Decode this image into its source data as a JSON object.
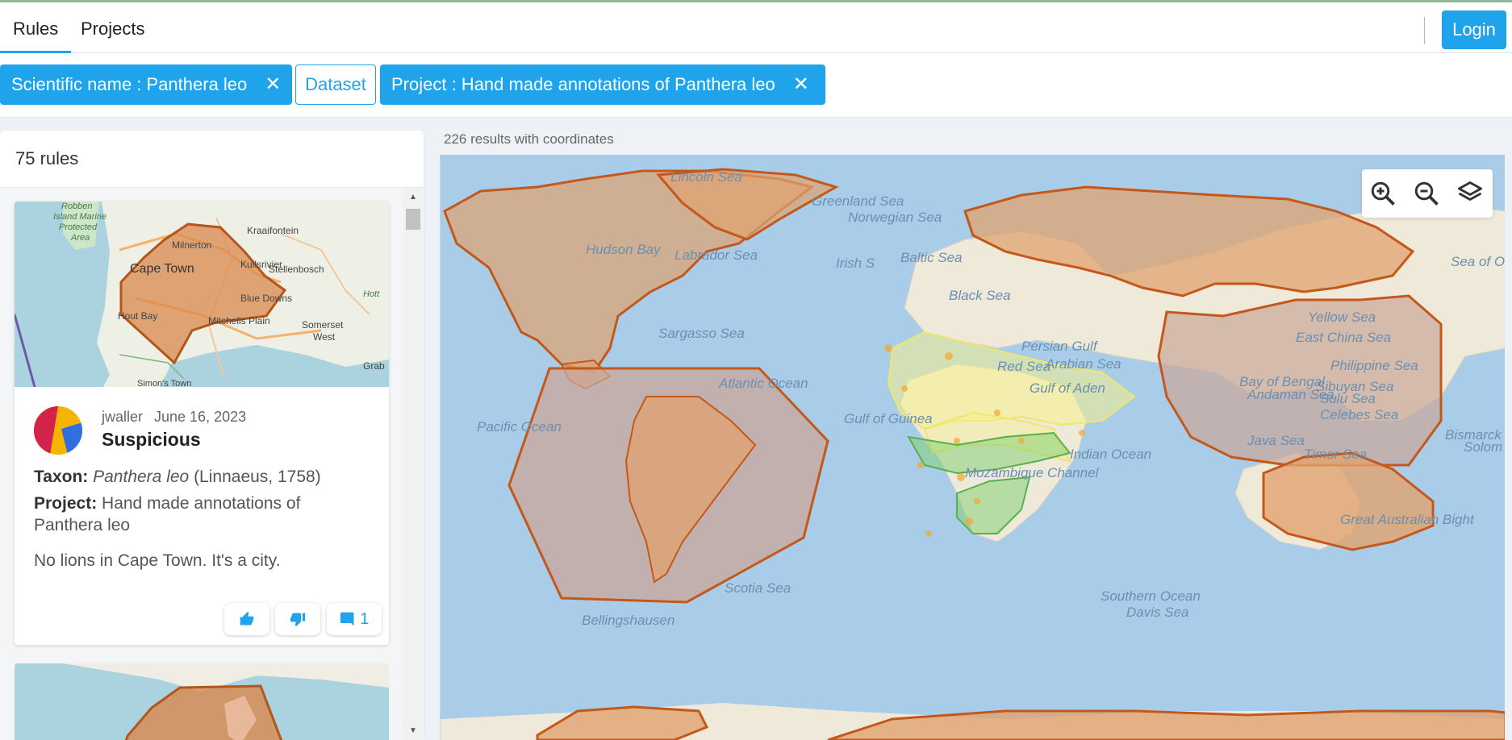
{
  "nav": {
    "tabs": [
      {
        "label": "Rules",
        "active": true
      },
      {
        "label": "Projects",
        "active": false
      }
    ],
    "login_label": "Login"
  },
  "filters": {
    "scientific_name": "Scientific name : Panthera leo",
    "dataset": "Dataset",
    "project": "Project : Hand made annotations of Panthera leo",
    "close_glyph": "✕"
  },
  "rules_panel": {
    "count_label": "75 rules",
    "cards": [
      {
        "map_labels": {
          "robben": "Robben Island Marine Protected Area",
          "cape_town": "Cape Town",
          "milnerton": "Milnerton",
          "kraaifontein": "Kraaifontein",
          "kuilsrivier": "Kuilsrivier",
          "stellenbosch": "Stellenbosch",
          "blue_downs": "Blue Downs",
          "hout_bay": "Hout Bay",
          "mitchells_plain": "Mitchells Plain",
          "somerset_west": "Somerset West",
          "simons_town": "Simon's Town",
          "grab": "Grab",
          "hott": "Hott"
        },
        "user": "jwaller",
        "date": "June 16, 2023",
        "verdict": "Suspicious",
        "taxon_label": "Taxon:",
        "taxon_name": "Panthera leo",
        "taxon_author": "(Linnaeus, 1758)",
        "project_label": "Project:",
        "project_value": "Hand made annotations of Panthera leo",
        "comment": "No lions in Cape Town. It's a city.",
        "comment_count": "1"
      }
    ]
  },
  "map": {
    "results_label": "226 results with coordinates",
    "labels": {
      "lincoln_sea": "Lincoln Sea",
      "greenland_sea": "Greenland Sea",
      "norwegian_sea": "Norwegian Sea",
      "hudson_bay": "Hudson Bay",
      "labrador_sea": "Labrador Sea",
      "irish_sea": "Irish S",
      "baltic_sea": "Baltic Sea",
      "black_sea": "Black Sea",
      "sea_of_okhotsk": "Sea of Ok",
      "sargasso_sea": "Sargasso Sea",
      "persian_gulf": "Persian Gulf",
      "yellow_sea": "Yellow Sea",
      "east_china_sea": "East China Sea",
      "philippine_sea": "Philippine Sea",
      "red_sea": "Red Sea",
      "arabian_sea": "Arabian Sea",
      "atlantic_ocean": "Atlantic Ocean",
      "gulf_of_aden": "Gulf of Aden",
      "bay_of_bengal": "Bay of Bengal",
      "andaman_sea": "Andaman Sea",
      "sibuyan_sea": "Sibuyan Sea",
      "sulu_sea": "Sulu Sea",
      "pacific_ocean": "Pacific Ocean",
      "gulf_of_guinea": "Gulf of Guinea",
      "celebes_sea": "Celebes Sea",
      "bismarck": "Bismarck",
      "solom": "Solom",
      "indian_ocean": "Indian Ocean",
      "java_sea": "Java Sea",
      "timor_sea": "Timor Sea",
      "mozambique_channel": "Mozambique Channel",
      "great_australian_bight": "Great Australian Bight",
      "scotia_sea": "Scotia Sea",
      "southern_ocean": "Southern Ocean",
      "davis_sea": "Davis Sea",
      "bellingshausen": "Bellingshausen"
    },
    "colors": {
      "annotation_stroke": "#c4581a",
      "annotation_fill": "#e0a26f",
      "range_yellow": "#f6f08a",
      "range_green": "#7fcf6e",
      "ocean": "#a9cde9",
      "land": "#efe9d9"
    }
  },
  "icons": {
    "zoom_in": "zoom-in-icon",
    "zoom_out": "zoom-out-icon",
    "layers": "layers-icon",
    "thumbs_up": "thumbs-up-icon",
    "thumbs_down": "thumbs-down-icon",
    "comment": "comment-icon"
  }
}
